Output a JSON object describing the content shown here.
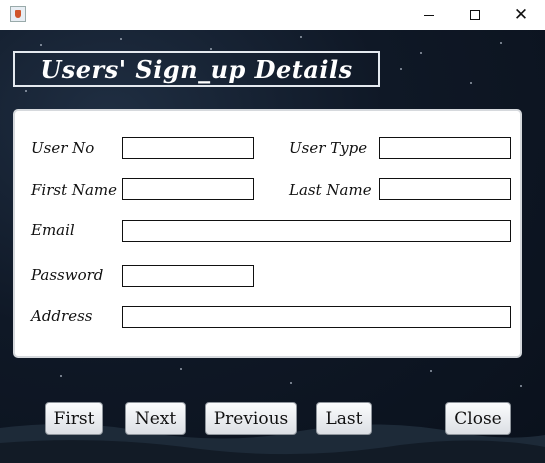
{
  "window": {
    "minimize_icon": "minimize-icon",
    "maximize_icon": "maximize-icon",
    "close_icon": "close-icon",
    "close_glyph": "✕"
  },
  "form": {
    "title": "Users' Sign_up Details",
    "labels": {
      "user_no": "User No",
      "user_type": "User Type",
      "first_name": "First Name",
      "last_name": "Last Name",
      "email": "Email",
      "password": "Password",
      "address": "Address"
    },
    "values": {
      "user_no": "",
      "user_type": "",
      "first_name": "",
      "last_name": "",
      "email": "",
      "password": "",
      "address": ""
    }
  },
  "buttons": {
    "first": "First",
    "next": "Next",
    "previous": "Previous",
    "last": "Last",
    "close": "Close"
  }
}
